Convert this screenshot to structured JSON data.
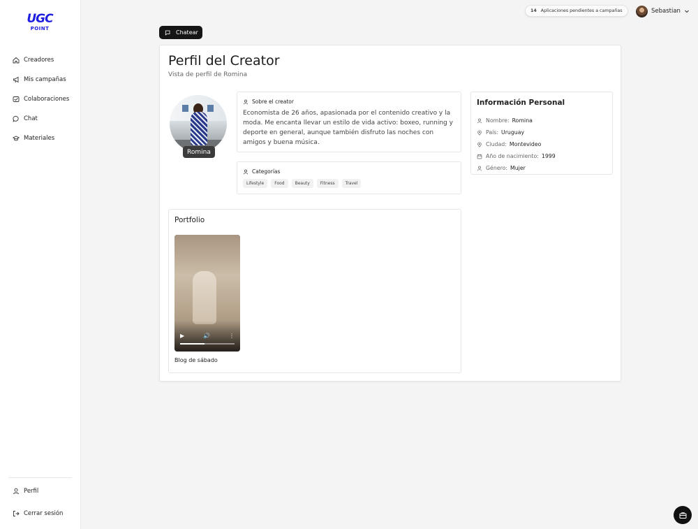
{
  "brand": {
    "logo_line1": "UGC",
    "logo_line2": "POINT"
  },
  "sidebar": {
    "items": [
      {
        "label": "Creadores",
        "icon": "home-icon"
      },
      {
        "label": "Mis campañas",
        "icon": "megaphone-icon"
      },
      {
        "label": "Colaboraciones",
        "icon": "handshake-icon"
      },
      {
        "label": "Chat",
        "icon": "chat-icon"
      },
      {
        "label": "Materiales",
        "icon": "graduation-cap-icon"
      }
    ],
    "bottom": [
      {
        "label": "Perfil",
        "icon": "user-icon"
      },
      {
        "label": "Cerrar sesión",
        "icon": "logout-icon"
      }
    ]
  },
  "topbar": {
    "pending_count": "14",
    "pending_text": "Aplicaciones pendientes a campañas",
    "user_name": "Sebastian"
  },
  "actions": {
    "chat_button": "Chatear"
  },
  "profile": {
    "title": "Perfil del Creator",
    "subtitle": "Vista de perfil de Romina",
    "name_tag": "Romina",
    "about_heading": "Sobre el creator",
    "about_text": "Economista de 26 años, apasionada por el contenido creativo y la moda. Me encanta llevar un estilo de vida activo: boxeo, running y deporte en general, aunque también disfruto las noches con amigos y buena música.",
    "categories_heading": "Categorías",
    "categories": [
      "Lifestyle",
      "Food",
      "Beauty",
      "Fitness",
      "Travel"
    ]
  },
  "info": {
    "title": "Información Personal",
    "rows": [
      {
        "label": "Nombre:",
        "value": "Romina"
      },
      {
        "label": "País:",
        "value": "Uruguay"
      },
      {
        "label": "Ciudad:",
        "value": "Montevideo"
      },
      {
        "label": "Año de nacimiento:",
        "value": "1999"
      },
      {
        "label": "Género:",
        "value": "Mujer"
      }
    ]
  },
  "portfolio": {
    "title": "Portfolio",
    "video_caption": "Blog de sábado",
    "video_progress": 0.45
  },
  "colors": {
    "accent": "#1e1ee0",
    "dark": "#151515"
  }
}
